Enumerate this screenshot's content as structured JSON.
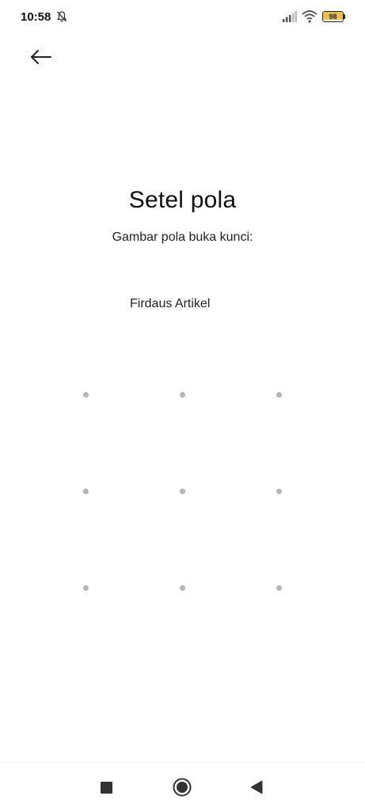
{
  "status_bar": {
    "time": "10:58",
    "battery_text": "98",
    "battery_level": 0.98,
    "battery_color": "#f0c24a",
    "icons": [
      "notifications-muted-icon",
      "signal-icon",
      "wifi-icon",
      "battery-icon"
    ]
  },
  "header": {
    "back_icon": "arrow-left-icon"
  },
  "main": {
    "title": "Setel pola",
    "instruction": "Gambar pola buka kunci:",
    "account_name": "Firdaus Artikel"
  },
  "pattern": {
    "rows": 3,
    "columns": 3,
    "dot_color": "#b5b5b5"
  },
  "nav_bar": {
    "icons": [
      "recents-square-icon",
      "home-circle-icon",
      "back-triangle-icon"
    ]
  }
}
